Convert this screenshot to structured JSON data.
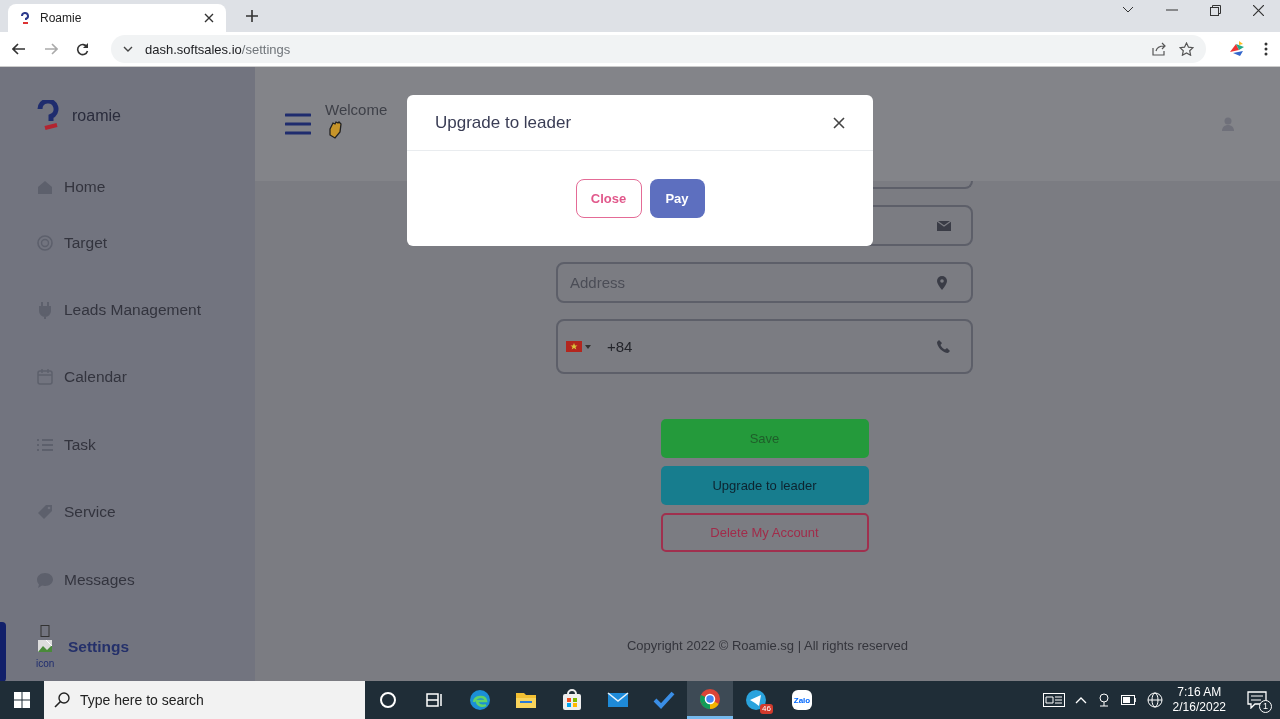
{
  "browser": {
    "tab_title": "Roamie",
    "url_host": "dash.softsales.io",
    "url_path": "/settings"
  },
  "sidebar": {
    "brand": "roamie",
    "items": [
      {
        "label": "Home",
        "kind": "home",
        "selected": false
      },
      {
        "label": "Target",
        "kind": "target",
        "selected": false
      },
      {
        "label": "Leads Management",
        "kind": "leads",
        "selected": false
      },
      {
        "label": "Calendar",
        "kind": "calendar",
        "selected": false
      },
      {
        "label": "Task",
        "kind": "task",
        "selected": false
      },
      {
        "label": "Service",
        "kind": "service",
        "selected": false
      },
      {
        "label": "Messages",
        "kind": "messages",
        "selected": false
      },
      {
        "label": "Settings",
        "kind": "settings",
        "icon_alt": "icon",
        "selected": true
      }
    ]
  },
  "header": {
    "greeting": "Welcome"
  },
  "form": {
    "fields": [
      {
        "kind": "partial"
      },
      {
        "kind": "email"
      },
      {
        "kind": "address",
        "placeholder": "Address"
      },
      {
        "kind": "phone",
        "value": "+84"
      }
    ],
    "buttons": [
      {
        "kind": "save",
        "label": "Save"
      },
      {
        "kind": "upgrade",
        "label": "Upgrade to leader"
      },
      {
        "kind": "delete",
        "label": "Delete My Account"
      }
    ]
  },
  "footer": {
    "copyright": "Copyright 2022 © Roamie.sg | All rights reserved"
  },
  "modal": {
    "title": "Upgrade to leader",
    "buttons": [
      {
        "kind": "close",
        "label": "Close"
      },
      {
        "kind": "pay",
        "label": "Pay"
      }
    ]
  },
  "taskbar": {
    "search_placeholder": "Type here to search",
    "apps": [
      {
        "kind": "cortana",
        "selected": false
      },
      {
        "kind": "taskview",
        "selected": false
      },
      {
        "kind": "edge",
        "selected": false
      },
      {
        "kind": "explorer",
        "selected": false
      },
      {
        "kind": "store",
        "selected": false
      },
      {
        "kind": "mail",
        "selected": false
      },
      {
        "kind": "todo",
        "selected": false
      },
      {
        "kind": "chrome",
        "selected": true
      },
      {
        "kind": "telegram",
        "selected": false,
        "badge": "46"
      },
      {
        "kind": "zalo",
        "selected": false,
        "label": "Zalo"
      }
    ],
    "time": "7:16 AM",
    "date": "2/16/2022",
    "notification_count": "1"
  }
}
